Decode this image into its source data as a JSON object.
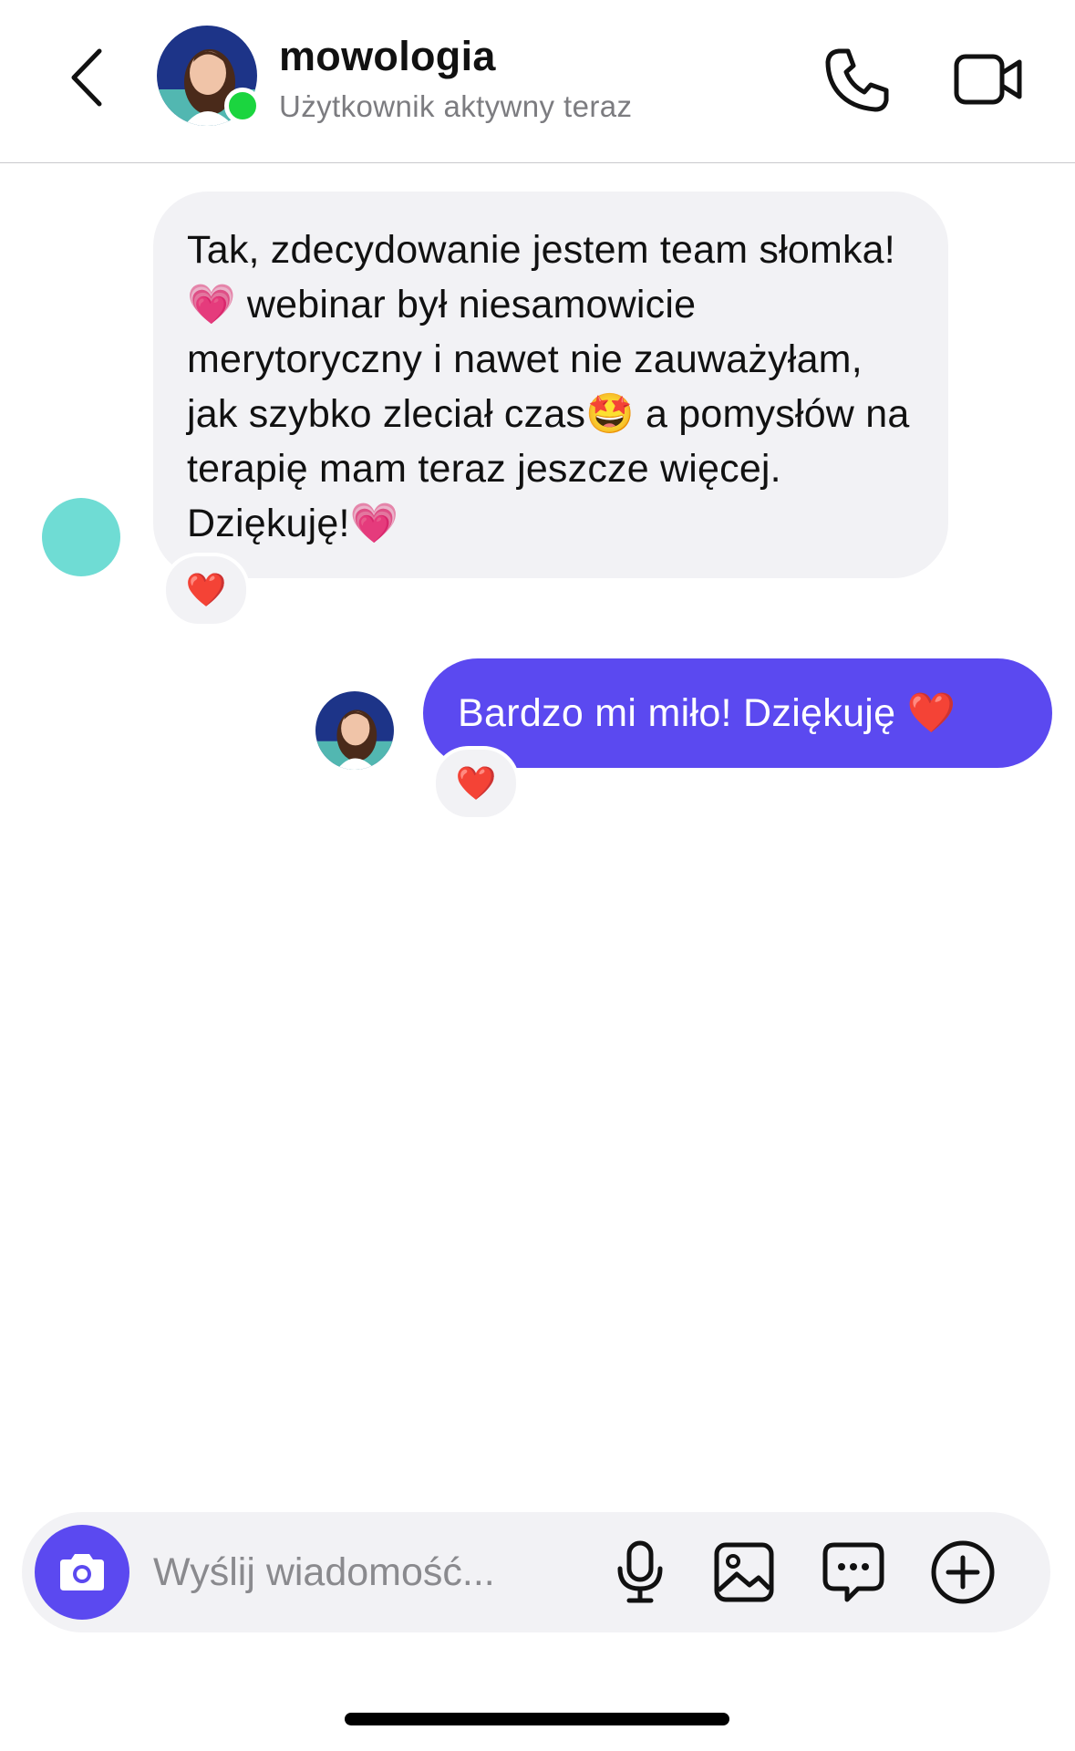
{
  "header": {
    "contact_name": "mowologia",
    "status": "Użytkownik aktywny teraz"
  },
  "icons": {
    "back": "chevron-left-icon",
    "call": "phone-icon",
    "video": "video-camera-icon",
    "camera": "camera-icon",
    "mic": "microphone-icon",
    "gallery": "image-icon",
    "sticker": "chat-bubble-dots-icon",
    "plus": "plus-circle-icon"
  },
  "messages": [
    {
      "direction": "incoming",
      "text": "Tak, zdecydowanie jestem team słomka!💗 webinar był niesamowicie merytoryczny i nawet nie zauważyłam, jak szybko zleciał czas🤩 a pomysłów na terapię mam teraz jeszcze więcej. Dziękuję!💗",
      "reaction": "❤️"
    },
    {
      "direction": "outgoing",
      "text": "Bardzo mi miło! Dziękuję ❤️",
      "reaction": "❤️"
    }
  ],
  "composer": {
    "placeholder": "Wyślij wiadomość..."
  },
  "colors": {
    "accent": "#5b49f0",
    "incoming_bubble": "#f2f2f5",
    "online": "#1bd53f",
    "placeholder_avatar": "#6fdcd4"
  }
}
